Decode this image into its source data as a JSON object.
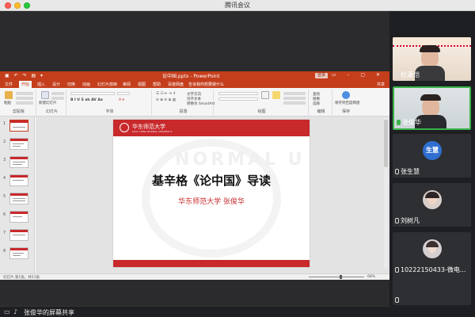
{
  "window": {
    "title": "腾讯会议"
  },
  "ppt": {
    "title": "论中国.pptx - PowerPoint",
    "login_label": "登录",
    "share_label": "共享",
    "tabs": [
      "文件",
      "开始",
      "插入",
      "设计",
      "切换",
      "动画",
      "幻灯片放映",
      "审阅",
      "视图",
      "帮助",
      "百度网盘",
      "告诉我你想要做什么"
    ],
    "active_tab": "开始",
    "ribbon_groups": [
      "剪贴板",
      "幻灯片",
      "字体",
      "段落",
      "绘图",
      "编辑",
      "保存"
    ],
    "ribbon_buttons": {
      "paste": "粘贴",
      "new_slide": "新建幻灯片",
      "text_direction": "文字方向",
      "align_text": "对齐文本",
      "smartart": "转换为 SmartArt",
      "find": "查找",
      "replace": "替换",
      "select": "选择",
      "save_baidu": "保存到百度网盘"
    },
    "slide_numbers": [
      "1",
      "2",
      "3",
      "4",
      "5",
      "6",
      "7",
      "8"
    ],
    "status_left": "幻灯片 第1张，共51张",
    "zoom": "68%"
  },
  "slide": {
    "school_name": "华东师范大学",
    "school_en": "EAST CHINA NORMAL UNIVERSITY",
    "watermark": "NORMAL U",
    "title": "基辛格《论中国》导读",
    "subtitle": "华东师范大学   张俊华"
  },
  "bottom_bar": {
    "label": "张俊华的屏幕共享"
  },
  "participants": [
    {
      "name": "杜潇恺",
      "mic": "on"
    },
    {
      "name": "张俊华",
      "mic": "active"
    },
    {
      "name": "张生慧",
      "avatar_text": "生慧",
      "mic": "off"
    },
    {
      "name": "刘树凡",
      "mic": "off"
    },
    {
      "name": "10222150433-微电...",
      "mic": "off"
    },
    {
      "name": "",
      "mic": "off"
    }
  ],
  "colors": {
    "ppt_red": "#c43e1c",
    "slide_red": "#c8292b",
    "speaking_green": "#3ab54a",
    "avatar_blue": "#2f6fd0"
  }
}
